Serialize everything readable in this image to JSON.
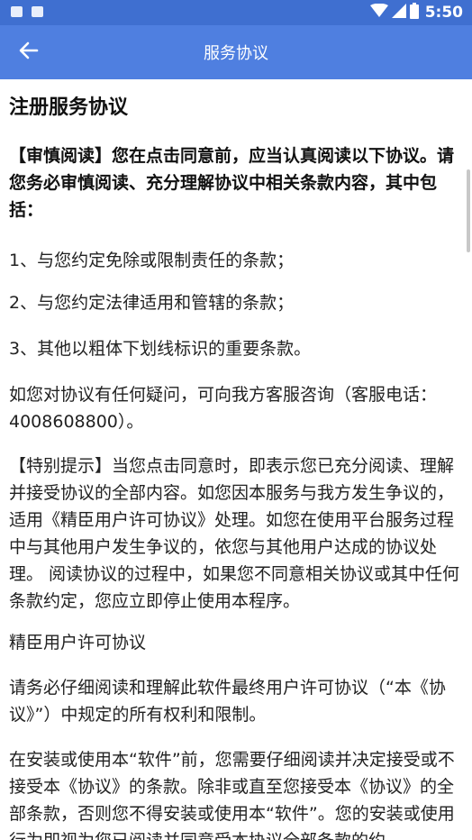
{
  "status_bar": {
    "time": "5:50"
  },
  "app_bar": {
    "title": "服务协议"
  },
  "document": {
    "title": "注册服务协议",
    "paragraphs": [
      "【审慎阅读】您在点击同意前，应当认真阅读以下协议。请您务必审慎阅读、充分理解协议中相关条款内容，其中包括：",
      "1、与您约定免除或限制责任的条款；",
      "2、与您约定法律适用和管辖的条款；",
      "3、其他以粗体下划线标识的重要条款。",
      "如您对协议有任何疑问，可向我方客服咨询（客服电话：4008608800）。",
      "【特别提示】当您点击同意时，即表示您已充分阅读、理解并接受协议的全部内容。如您因本服务与我方发生争议的，适用《精臣用户许可协议》处理。如您在使用平台服务过程中与其他用户发生争议的，依您与其他用户达成的协议处理。 阅读协议的过程中，如果您不同意相关协议或其中任何条款约定，您应立即停止使用本程序。",
      "精臣用户许可协议",
      "请务必仔细阅读和理解此软件最终用户许可协议（“本《协议》”）中规定的所有权利和限制。",
      "在安装或使用本“软件”前，您需要仔细阅读并决定接受或不接受本《协议》的条款。除非或直至您接受本《协议》的全部条款，否则您不得安装或使用本“软件”。您的安装或使用行为即视为您已阅读并同意受本协议全部条款的约"
    ]
  }
}
